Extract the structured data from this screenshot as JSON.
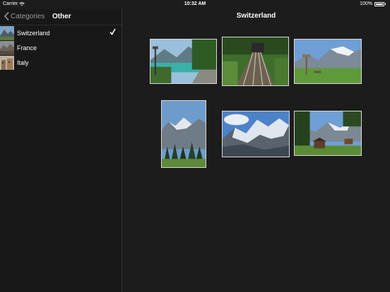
{
  "status_bar": {
    "carrier": "Carrier",
    "time": "10:32 AM",
    "battery": "100%"
  },
  "sidebar": {
    "back_label": "Categories",
    "title": "Other",
    "items": [
      {
        "label": "Switzerland",
        "selected": true
      },
      {
        "label": "France",
        "selected": false
      },
      {
        "label": "Italy",
        "selected": false
      }
    ]
  },
  "main": {
    "title": "Switzerland",
    "photos": [
      {
        "name": "lake-promenade"
      },
      {
        "name": "mountain-railway"
      },
      {
        "name": "alpine-meadow-signpost"
      },
      {
        "name": "forest-peaks-portrait"
      },
      {
        "name": "glacier-mountain"
      },
      {
        "name": "chalet-valley"
      }
    ]
  },
  "colors": {
    "background": "#1c1c1c",
    "sidebar": "#181818",
    "accent_text": "#9a9a9a"
  }
}
